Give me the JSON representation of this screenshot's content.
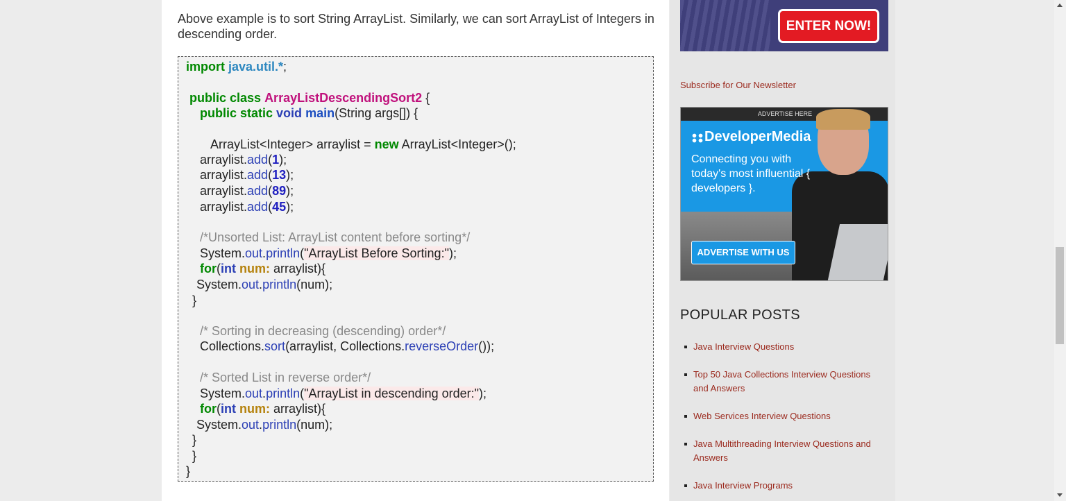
{
  "article": {
    "intro": "Above example is to sort String ArrayList. Similarly, we can sort ArrayList of Integers in descending order."
  },
  "code": {
    "l1": [
      "import",
      "java.util.*",
      ";"
    ],
    "l3": [
      "public class",
      "ArrayListDescendingSort2",
      " {"
    ],
    "l4": [
      "public static",
      "void",
      "main",
      "(String args[]) {"
    ],
    "l6": [
      "ArrayList<Integer> arraylist = ",
      "new",
      " ArrayList<Integer>();"
    ],
    "adds": [
      [
        "arraylist.",
        "add",
        "(",
        "1",
        ");"
      ],
      [
        "arraylist.",
        "add",
        "(",
        "13",
        ");"
      ],
      [
        "arraylist.",
        "add",
        "(",
        "89",
        ");"
      ],
      [
        "arraylist.",
        "add",
        "(",
        "45",
        ");"
      ]
    ],
    "c1": "/*Unsorted List: ArrayList content before sorting*/",
    "p1": [
      "System.",
      "out",
      ".",
      "println",
      "(",
      "\"ArrayList Before Sorting:\"",
      ");"
    ],
    "for1": [
      "for",
      "(",
      "int",
      " ",
      "num:",
      " arraylist){"
    ],
    "pn1": [
      "System.",
      "out",
      ".",
      "println",
      "(num);"
    ],
    "close_brace": "}",
    "c2": "/* Sorting in decreasing (descending) order*/",
    "sort": [
      "Collections.",
      "sort",
      "(arraylist, Collections.",
      "reverseOrder",
      "());"
    ],
    "c3": "/* Sorted List in reverse order*/",
    "p2": [
      "System.",
      "out",
      ".",
      "println",
      "(",
      "\"ArrayList in descending order:\"",
      ");"
    ]
  },
  "sidebar": {
    "enter_button": "ENTER NOW!",
    "newsletter": "Subscribe for Our Newsletter",
    "ad": {
      "advertise_here": "ADVERTISE HERE",
      "brand": "DeveloperMedia",
      "tagline": "Connecting you with today's most influential { developers }.",
      "button": "ADVERTISE WITH US"
    },
    "popular_title": "POPULAR POSTS",
    "posts": [
      "Java Interview Questions",
      "Top 50 Java Collections Interview Questions and Answers",
      "Web Services Interview Questions",
      "Java Multithreading Interview Questions and Answers",
      "Java Interview Programs"
    ]
  },
  "colors": {
    "link": "#9b2a1e",
    "enter_button": "#e31b23",
    "ad_blue": "#1a98e4",
    "keyword_green": "#008800",
    "class_name": "#c0117c"
  },
  "icons": [
    "developer-media-logo-icon",
    "scroll-up-icon",
    "scroll-down-icon"
  ]
}
